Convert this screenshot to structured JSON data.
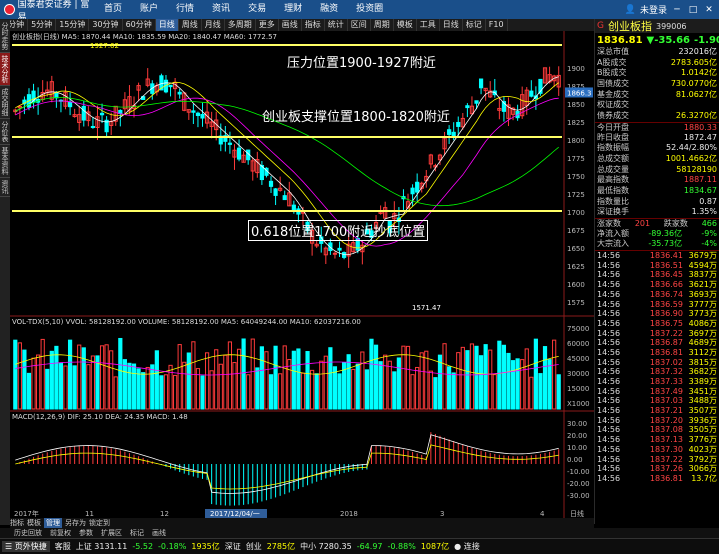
{
  "topbar": {
    "logo": "国泰君安证券 | 富易",
    "menu": [
      "首页",
      "账户",
      "行情",
      "资讯",
      "交易",
      "理财",
      "融资",
      "投资圈"
    ],
    "user": "未登录",
    "win_buttons": [
      "─",
      "□",
      "✕"
    ]
  },
  "toolbar": {
    "items": [
      "1分钟",
      "5分钟",
      "15分钟",
      "30分钟",
      "60分钟",
      "日线",
      "周线",
      "月线",
      "多周期",
      "更多",
      "画线",
      "指标",
      "统计",
      "区间",
      "周期",
      "模板",
      "工具",
      "日线",
      "标记",
      "F10"
    ]
  },
  "vtabs": [
    "分时走势",
    "技术分析",
    "成交明细",
    "分价表",
    "基本资料",
    "资讯"
  ],
  "legends": {
    "main": "创业板指(日线) MA5: 1870.44  MA10: 1835.59  MA20: 1840.47  MA60: 1772.57",
    "vol": "VOL-TDX(5,10)  VVOL: 58128192.00  VOLUME: 58128192.00  MA5: 64049244.00  MA10: 62037216.00",
    "macd": "MACD(12,26,9)  DIF: 25.10  DEA: 24.35  MACD: 1.48"
  },
  "annotations": {
    "resistance": "压力位置1900-1927附近",
    "support": "创业板支撑位置1800-1820附近",
    "fib": "0.618位置1700附近抄底位置",
    "high_label": "1927.62",
    "low_label": "1571.47"
  },
  "axes": {
    "price": [
      "1900",
      "1875",
      "1850",
      "1825",
      "1800",
      "1775",
      "1750",
      "1725",
      "1700",
      "1675",
      "1650",
      "1625",
      "1600",
      "1575"
    ],
    "current_price": "1866.3",
    "vol": [
      "75000",
      "60000",
      "45000",
      "30000",
      "15000",
      "X1000"
    ],
    "macd": [
      "30.00",
      "20.00",
      "10.00",
      "0.00",
      "-10.00",
      "-20.00",
      "-30.00"
    ],
    "dates": [
      "2017年",
      "11",
      "12",
      "2017/12/04/一",
      "2018",
      "3",
      "4",
      "日线"
    ]
  },
  "panel": {
    "badge": "G",
    "name": "创业板指",
    "code": "399006",
    "price": "1836.81",
    "change": "▼-35.66",
    "pct": "-1.90%",
    "stats": [
      {
        "k": "深总市值",
        "v": "232016亿",
        "c": "w"
      },
      {
        "k": "A股成交",
        "v": "2783.605亿",
        "c": "y"
      },
      {
        "k": "B股成交",
        "v": "1.0142亿",
        "c": "y"
      },
      {
        "k": "国债成交",
        "v": "730.0770亿",
        "c": "y"
      },
      {
        "k": "基金成交",
        "v": "81.0627亿",
        "c": "y"
      },
      {
        "k": "权证成交",
        "v": "",
        "c": "y"
      },
      {
        "k": "债券成交",
        "v": "26.3270亿",
        "c": "y"
      },
      {
        "k": "今日开盘",
        "v": "1880.33",
        "c": "r",
        "sep": true
      },
      {
        "k": "昨日收盘",
        "v": "1872.47",
        "c": "w"
      },
      {
        "k": "指数振幅",
        "v": "52.44/2.80%",
        "c": "w"
      },
      {
        "k": "总成交额",
        "v": "1001.4662亿",
        "c": "y"
      },
      {
        "k": "总成交量",
        "v": "58128190",
        "c": "y"
      },
      {
        "k": "最高指数",
        "v": "1887.11",
        "c": "r"
      },
      {
        "k": "最低指数",
        "v": "1834.67",
        "c": "g"
      },
      {
        "k": "指数量比",
        "v": "0.87",
        "c": "w"
      },
      {
        "k": "深证换手",
        "v": "1.35%",
        "c": "w"
      }
    ],
    "updown": {
      "k": "涨家数",
      "up": "201",
      "k2": "跌家数",
      "down": "466"
    },
    "flows": [
      {
        "k": "净流入额",
        "v": "-89.36亿",
        "p": "-9%"
      },
      {
        "k": "大宗流入",
        "v": "-35.73亿",
        "p": "-4%"
      }
    ],
    "ticks": [
      [
        "14:56",
        "1836.41",
        "3679万"
      ],
      [
        "14:56",
        "1836.51",
        "4594万"
      ],
      [
        "14:56",
        "1836.45",
        "3837万"
      ],
      [
        "14:56",
        "1836.66",
        "3621万"
      ],
      [
        "14:56",
        "1836.74",
        "3693万"
      ],
      [
        "14:56",
        "1836.59",
        "3777万"
      ],
      [
        "14:56",
        "1836.90",
        "3773万"
      ],
      [
        "14:56",
        "1836.75",
        "4086万"
      ],
      [
        "14:56",
        "1837.22",
        "3697万"
      ],
      [
        "14:56",
        "1836.87",
        "4689万"
      ],
      [
        "14:56",
        "1836.81",
        "3112万"
      ],
      [
        "14:56",
        "1837.02",
        "3815万"
      ],
      [
        "14:56",
        "1837.32",
        "3682万"
      ],
      [
        "14:56",
        "1837.33",
        "3389万"
      ],
      [
        "14:56",
        "1837.49",
        "3451万"
      ],
      [
        "14:56",
        "1837.03",
        "3488万"
      ],
      [
        "14:56",
        "1837.21",
        "3507万"
      ],
      [
        "14:56",
        "1837.20",
        "3936万"
      ],
      [
        "14:56",
        "1837.08",
        "3505万"
      ],
      [
        "14:56",
        "1837.13",
        "3776万"
      ],
      [
        "14:56",
        "1837.30",
        "4023万"
      ],
      [
        "14:56",
        "1837.22",
        "3792万"
      ],
      [
        "14:56",
        "1837.26",
        "3066万"
      ],
      [
        "14:56",
        "1836.81",
        "13.7亿"
      ]
    ]
  },
  "bottomtabs": [
    "指标",
    "模板",
    "管理",
    "另存为",
    "锁定到"
  ],
  "bottomtabs_active": "管理",
  "midbar": {
    "items": [
      "历史回放",
      "前复权",
      "参数",
      "扩展区",
      "标记",
      "画线"
    ]
  },
  "statusbar": {
    "items": [
      {
        "t": "☰ 页外快捷",
        "c": "btn"
      },
      {
        "t": "客服",
        "c": "w"
      },
      {
        "t": "上证 3131.11",
        "c": "w"
      },
      {
        "t": "-5.52",
        "c": "g"
      },
      {
        "t": "-0.18%",
        "c": "g"
      },
      {
        "t": "1935亿",
        "c": "y"
      },
      {
        "t": "深证",
        "c": "w"
      },
      {
        "t": "创业",
        "c": "w"
      },
      {
        "t": "2785亿",
        "c": "y"
      },
      {
        "t": "中小 7280.35",
        "c": "w"
      },
      {
        "t": "-64.97",
        "c": "g"
      },
      {
        "t": "-0.88%",
        "c": "g"
      },
      {
        "t": "1087亿",
        "c": "y"
      },
      {
        "t": "● 连接",
        "c": "w"
      }
    ]
  },
  "colors": {
    "up": "#ff3b3b",
    "down": "#00ffff",
    "ma5": "#ffffff",
    "ma10": "#ffff00",
    "ma20": "#ff00ff",
    "ma60": "#00ff00",
    "support_line": "#ffff66"
  }
}
